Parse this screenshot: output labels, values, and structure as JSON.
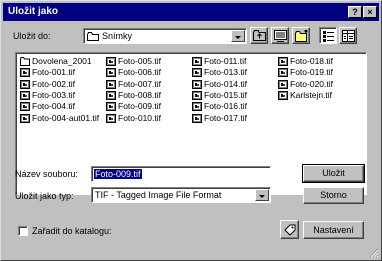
{
  "window": {
    "title": "Uložit jako",
    "help_label": "?",
    "close_label": "×"
  },
  "save_in": {
    "label": "Uložit do:",
    "value": "Snímky"
  },
  "files": [
    {
      "name": "Dovolena_2001",
      "type": "folder"
    },
    {
      "name": "Foto-001.tif",
      "type": "tif"
    },
    {
      "name": "Foto-002.tif",
      "type": "tif"
    },
    {
      "name": "Foto-003.tif",
      "type": "tif"
    },
    {
      "name": "Foto-004.tif",
      "type": "tif"
    },
    {
      "name": "Foto-004-aut01.tif",
      "type": "tif"
    },
    {
      "name": "Foto-005.tif",
      "type": "tif"
    },
    {
      "name": "Foto-006.tif",
      "type": "tif"
    },
    {
      "name": "Foto-007.tif",
      "type": "tif"
    },
    {
      "name": "Foto-008.tif",
      "type": "tif"
    },
    {
      "name": "Foto-009.tif",
      "type": "tif"
    },
    {
      "name": "Foto-010.tif",
      "type": "tif"
    },
    {
      "name": "Foto-011.tif",
      "type": "tif"
    },
    {
      "name": "Foto-013.tif",
      "type": "tif"
    },
    {
      "name": "Foto-014.tif",
      "type": "tif"
    },
    {
      "name": "Foto-015.tif",
      "type": "tif"
    },
    {
      "name": "Foto-016.tif",
      "type": "tif"
    },
    {
      "name": "Foto-017.tif",
      "type": "tif"
    },
    {
      "name": "Foto-018.tif",
      "type": "tif"
    },
    {
      "name": "Foto-019.tif",
      "type": "tif"
    },
    {
      "name": "Foto-020.tif",
      "type": "tif"
    },
    {
      "name": "Karlstejn.tif",
      "type": "tif"
    }
  ],
  "filename": {
    "label": "Název souboru:",
    "value": "Foto-009.tif"
  },
  "filetype": {
    "label": "Uložit jako typ:",
    "value": "TIF - Tagged Image File Format"
  },
  "catalog": {
    "label": "Zařadit do katalogu:",
    "checked": false
  },
  "buttons": {
    "save": "Uložit",
    "cancel": "Storno",
    "settings": "Nastavení"
  },
  "colors": {
    "title_bar": "#000080",
    "face": "#c0c0c0",
    "selection": "#000080"
  }
}
